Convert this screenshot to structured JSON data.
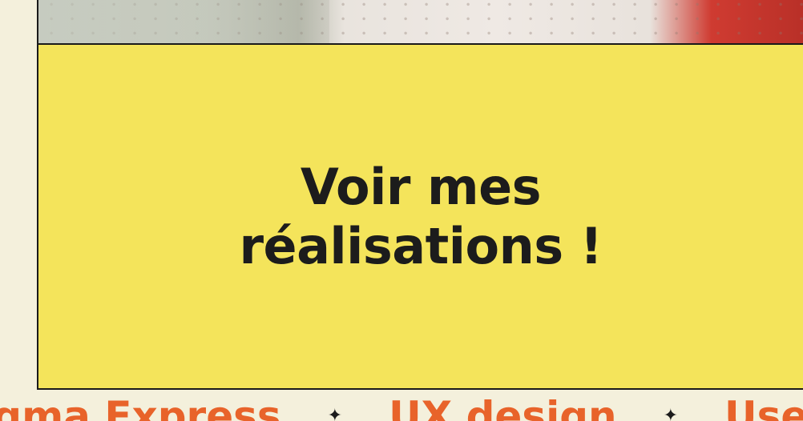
{
  "cta": {
    "label": "Voir mes réalisations !"
  },
  "marquee": {
    "items": [
      "Figma Express",
      "UX design",
      "User flow"
    ],
    "separator": "✦"
  },
  "colors": {
    "background": "#f4f0dc",
    "cta_background": "#f4e45b",
    "marquee_text": "#e8632a",
    "text_dark": "#1c1c1c"
  }
}
